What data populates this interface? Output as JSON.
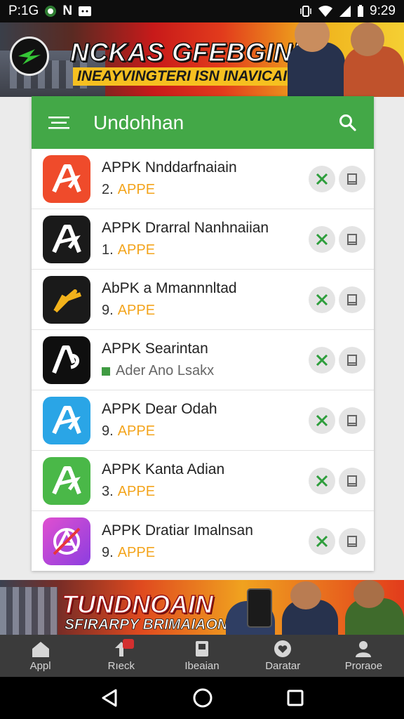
{
  "status_bar": {
    "left_text": "P:1G",
    "carrier_mark": "N",
    "time": "9:29",
    "icons": [
      "notification-icon",
      "n-icon",
      "message-icon",
      "vibrate-icon",
      "wifi-icon",
      "signal-icon",
      "battery-icon"
    ]
  },
  "top_banner": {
    "title": "NCKAS GFEBGINI",
    "subtitle": "INEAYVINGTERI ISN INAVICAI"
  },
  "app_bar": {
    "title": "Undohhan",
    "accent_color": "#43a847"
  },
  "apps": [
    {
      "name": "APPK Nnddarfnaiain",
      "meta_num": "2.",
      "meta_tag": "APPE",
      "icon_color": "#ef4b2b"
    },
    {
      "name": "APPK Drarral Nanhnaiian",
      "meta_num": "1.",
      "meta_tag": "APPE",
      "icon_color": "#1a1a1a"
    },
    {
      "name": "AbPK a Mmannnltad",
      "meta_num": "9.",
      "meta_tag": "APPE",
      "icon_color": "#1a1a1a"
    },
    {
      "name": "APPK Searintan",
      "meta_text": "Ader Ano Lsakx",
      "icon_color": "#0f0f0f"
    },
    {
      "name": "APPK Dear Odah",
      "meta_num": "9.",
      "meta_tag": "APPE",
      "icon_color": "#2aa5e6"
    },
    {
      "name": "APPK Kanta Adian",
      "meta_num": "3.",
      "meta_tag": "APPE",
      "icon_color": "#4ab848"
    },
    {
      "name": "APPK Dratiar Imalnsan",
      "meta_num": "9.",
      "meta_tag": "APPE",
      "icon_color": "#c23bd0"
    }
  ],
  "bottom_banner": {
    "title": "TUNDNOAIN",
    "subtitle": "SFIRARPY BRIMAIAON"
  },
  "bottom_nav": [
    {
      "label": "Appl",
      "icon": "home-icon"
    },
    {
      "label": "Rıeck",
      "icon": "upload-icon"
    },
    {
      "label": "Ibeaian",
      "icon": "book-icon"
    },
    {
      "label": "Daratar",
      "icon": "heart-icon"
    },
    {
      "label": "Proraoe",
      "icon": "person-icon"
    }
  ],
  "colors": {
    "tag": "#f3a41c",
    "action_green": "#2e9e3c"
  }
}
